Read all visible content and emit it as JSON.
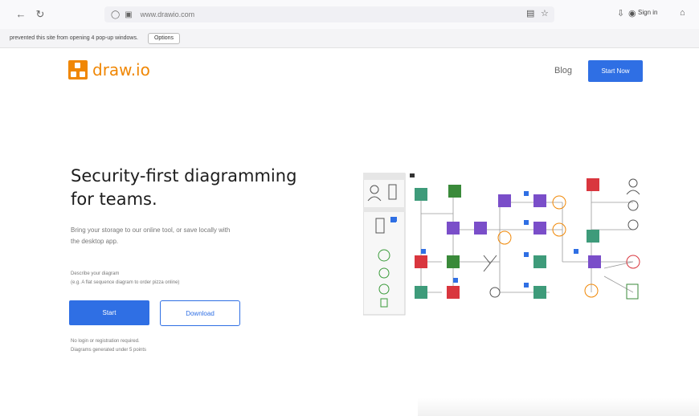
{
  "browser": {
    "url": "www.drawio.com",
    "signin_label": "Sign in"
  },
  "notification": {
    "text": "prevented this site from opening 4 pop-up windows.",
    "options_label": "Options"
  },
  "header": {
    "logo_text": "draw.io",
    "blog_label": "Blog",
    "start_now_label": "Start Now"
  },
  "hero": {
    "headline_line1": "Security-first diagramming",
    "headline_line2": "for teams.",
    "subline_line1": "Bring your storage to our online tool, or save locally with",
    "subline_line2": "the desktop app.",
    "describe_line1": "Describe your diagram",
    "describe_line2": "(e.g. A flat sequence diagram to order pizza online)",
    "start_label": "Start",
    "download_label": "Download",
    "fine_line1": "No login or registration required.",
    "fine_line2": "Diagrams generated under 5 points"
  },
  "colors": {
    "brand_orange": "#f08705",
    "primary_blue": "#2f6fe4"
  },
  "icons": [
    "back-arrow-icon",
    "reload-icon",
    "shield-icon",
    "lock-icon",
    "reader-icon",
    "star-icon",
    "download-icon",
    "account-icon",
    "menu-icon"
  ]
}
